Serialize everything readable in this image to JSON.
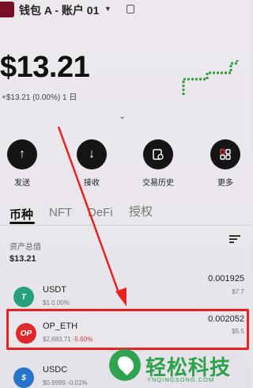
{
  "header": {
    "wallet_name": "钱包 A - 账户 01"
  },
  "balance": {
    "amount": "$13.21",
    "change": "+$13.21 (0.00%) 1 日"
  },
  "actions": [
    {
      "label": "发送",
      "icon": "arrow-up-icon"
    },
    {
      "label": "接收",
      "icon": "arrow-down-icon"
    },
    {
      "label": "交易历史",
      "icon": "history-icon"
    },
    {
      "label": "更多",
      "icon": "grid-icon"
    }
  ],
  "tabs": [
    "币种",
    "NFT",
    "DeFi",
    "授权"
  ],
  "assets": {
    "label": "资产总值",
    "value": "$13.21"
  },
  "tokens": [
    {
      "symbol": "USDT",
      "price": "$1",
      "change": "0.00%",
      "amount": "0.001925",
      "fiat": "$7.7",
      "color": "#26a17b"
    },
    {
      "symbol": "OP_ETH",
      "price": "$2,683.71",
      "change": "-5.60%",
      "amount": "0.002052",
      "fiat": "$5.5",
      "color": "#e0282c"
    },
    {
      "symbol": "USDC",
      "price": "$0.9999",
      "change": "-0.01%",
      "amount": "",
      "fiat": "",
      "color": "#2775ca"
    }
  ],
  "watermark": {
    "title": "轻松科技",
    "sub": "YNQINGSONG.COM"
  },
  "colors": {
    "highlight": "#e8231f",
    "accent_chart": "#2e9e3e",
    "background": "#ece8ee"
  }
}
